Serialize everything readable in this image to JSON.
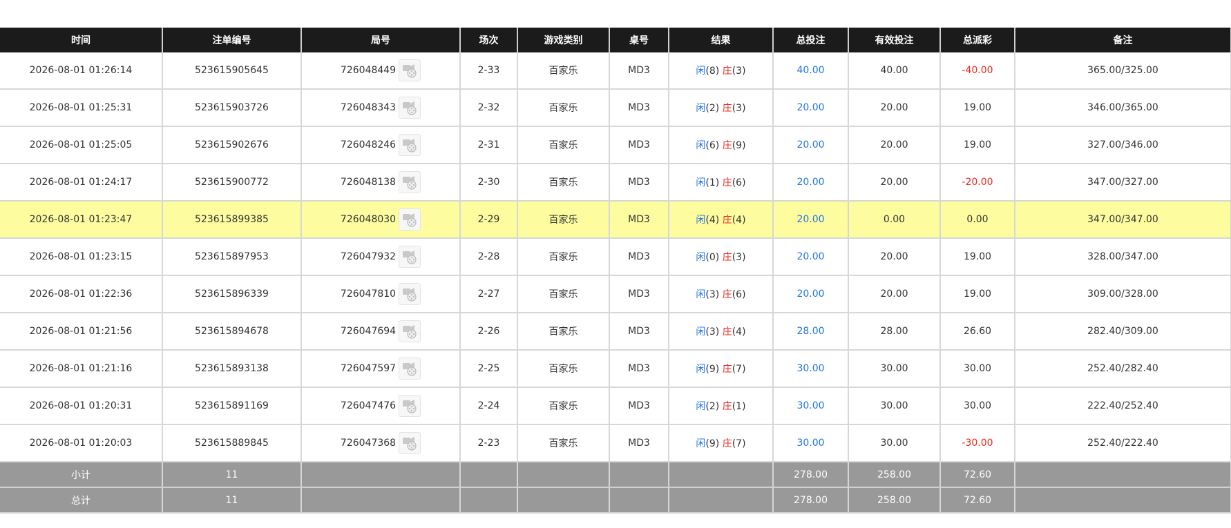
{
  "headers": [
    "时间",
    "注单编号",
    "局号",
    "场次",
    "游戏类别",
    "桌号",
    "结果",
    "总投注",
    "有效投注",
    "总派彩",
    "备注"
  ],
  "rows": [
    {
      "time": "2026-08-01 01:26:14",
      "bet_id": "523615905645",
      "game_no": "726048449",
      "round": "2-33",
      "category": "百家乐",
      "table": "MD3",
      "p_label": "闲",
      "p_val": "(8)",
      "b_label": "庄",
      "b_val": "(3)",
      "total_bet": "40.00",
      "valid_bet": "40.00",
      "payout": "-40.00",
      "payout_neg": true,
      "remark": "365.00/325.00"
    },
    {
      "time": "2026-08-01 01:25:31",
      "bet_id": "523615903726",
      "game_no": "726048343",
      "round": "2-32",
      "category": "百家乐",
      "table": "MD3",
      "p_label": "闲",
      "p_val": "(2)",
      "b_label": "庄",
      "b_val": "(3)",
      "total_bet": "20.00",
      "valid_bet": "20.00",
      "payout": "19.00",
      "payout_neg": false,
      "remark": "346.00/365.00"
    },
    {
      "time": "2026-08-01 01:25:05",
      "bet_id": "523615902676",
      "game_no": "726048246",
      "round": "2-31",
      "category": "百家乐",
      "table": "MD3",
      "p_label": "闲",
      "p_val": "(6)",
      "b_label": "庄",
      "b_val": "(9)",
      "total_bet": "20.00",
      "valid_bet": "20.00",
      "payout": "19.00",
      "payout_neg": false,
      "remark": "327.00/346.00"
    },
    {
      "time": "2026-08-01 01:24:17",
      "bet_id": "523615900772",
      "game_no": "726048138",
      "round": "2-30",
      "category": "百家乐",
      "table": "MD3",
      "p_label": "闲",
      "p_val": "(1)",
      "b_label": "庄",
      "b_val": "(6)",
      "total_bet": "20.00",
      "valid_bet": "20.00",
      "payout": "-20.00",
      "payout_neg": true,
      "remark": "347.00/327.00"
    },
    {
      "time": "2026-08-01 01:23:47",
      "bet_id": "523615899385",
      "game_no": "726048030",
      "round": "2-29",
      "category": "百家乐",
      "table": "MD3",
      "p_label": "闲",
      "p_val": "(4)",
      "b_label": "庄",
      "b_val": "(4)",
      "total_bet": "20.00",
      "valid_bet": "0.00",
      "payout": "0.00",
      "payout_neg": false,
      "remark": "347.00/347.00",
      "highlight": true
    },
    {
      "time": "2026-08-01 01:23:15",
      "bet_id": "523615897953",
      "game_no": "726047932",
      "round": "2-28",
      "category": "百家乐",
      "table": "MD3",
      "p_label": "闲",
      "p_val": "(0)",
      "b_label": "庄",
      "b_val": "(3)",
      "total_bet": "20.00",
      "valid_bet": "20.00",
      "payout": "19.00",
      "payout_neg": false,
      "remark": "328.00/347.00"
    },
    {
      "time": "2026-08-01 01:22:36",
      "bet_id": "523615896339",
      "game_no": "726047810",
      "round": "2-27",
      "category": "百家乐",
      "table": "MD3",
      "p_label": "闲",
      "p_val": "(3)",
      "b_label": "庄",
      "b_val": "(6)",
      "total_bet": "20.00",
      "valid_bet": "20.00",
      "payout": "19.00",
      "payout_neg": false,
      "remark": "309.00/328.00"
    },
    {
      "time": "2026-08-01 01:21:56",
      "bet_id": "523615894678",
      "game_no": "726047694",
      "round": "2-26",
      "category": "百家乐",
      "table": "MD3",
      "p_label": "闲",
      "p_val": "(3)",
      "b_label": "庄",
      "b_val": "(4)",
      "total_bet": "28.00",
      "valid_bet": "28.00",
      "payout": "26.60",
      "payout_neg": false,
      "remark": "282.40/309.00"
    },
    {
      "time": "2026-08-01 01:21:16",
      "bet_id": "523615893138",
      "game_no": "726047597",
      "round": "2-25",
      "category": "百家乐",
      "table": "MD3",
      "p_label": "闲",
      "p_val": "(9)",
      "b_label": "庄",
      "b_val": "(7)",
      "total_bet": "30.00",
      "valid_bet": "30.00",
      "payout": "30.00",
      "payout_neg": false,
      "remark": "252.40/282.40"
    },
    {
      "time": "2026-08-01 01:20:31",
      "bet_id": "523615891169",
      "game_no": "726047476",
      "round": "2-24",
      "category": "百家乐",
      "table": "MD3",
      "p_label": "闲",
      "p_val": "(2)",
      "b_label": "庄",
      "b_val": "(1)",
      "total_bet": "30.00",
      "valid_bet": "30.00",
      "payout": "30.00",
      "payout_neg": false,
      "remark": "222.40/252.40"
    },
    {
      "time": "2026-08-01 01:20:03",
      "bet_id": "523615889845",
      "game_no": "726047368",
      "round": "2-23",
      "category": "百家乐",
      "table": "MD3",
      "p_label": "闲",
      "p_val": "(9)",
      "b_label": "庄",
      "b_val": "(7)",
      "total_bet": "30.00",
      "valid_bet": "30.00",
      "payout": "-30.00",
      "payout_neg": true,
      "remark": "252.40/222.40"
    }
  ],
  "subtotal": {
    "label": "小计",
    "count": "11",
    "total_bet": "278.00",
    "valid_bet": "258.00",
    "payout": "72.60"
  },
  "grandtotal": {
    "label": "总计",
    "count": "11",
    "total_bet": "278.00",
    "valid_bet": "258.00",
    "payout": "72.60"
  },
  "colors": {
    "header_bg": "#1b1b1b",
    "player_blue": "#1f74e8",
    "banker_red": "#e8281c",
    "highlight_row": "#fdfd9f",
    "total_row_bg": "#999999"
  },
  "icons": {
    "replay": "video-replay-icon"
  }
}
